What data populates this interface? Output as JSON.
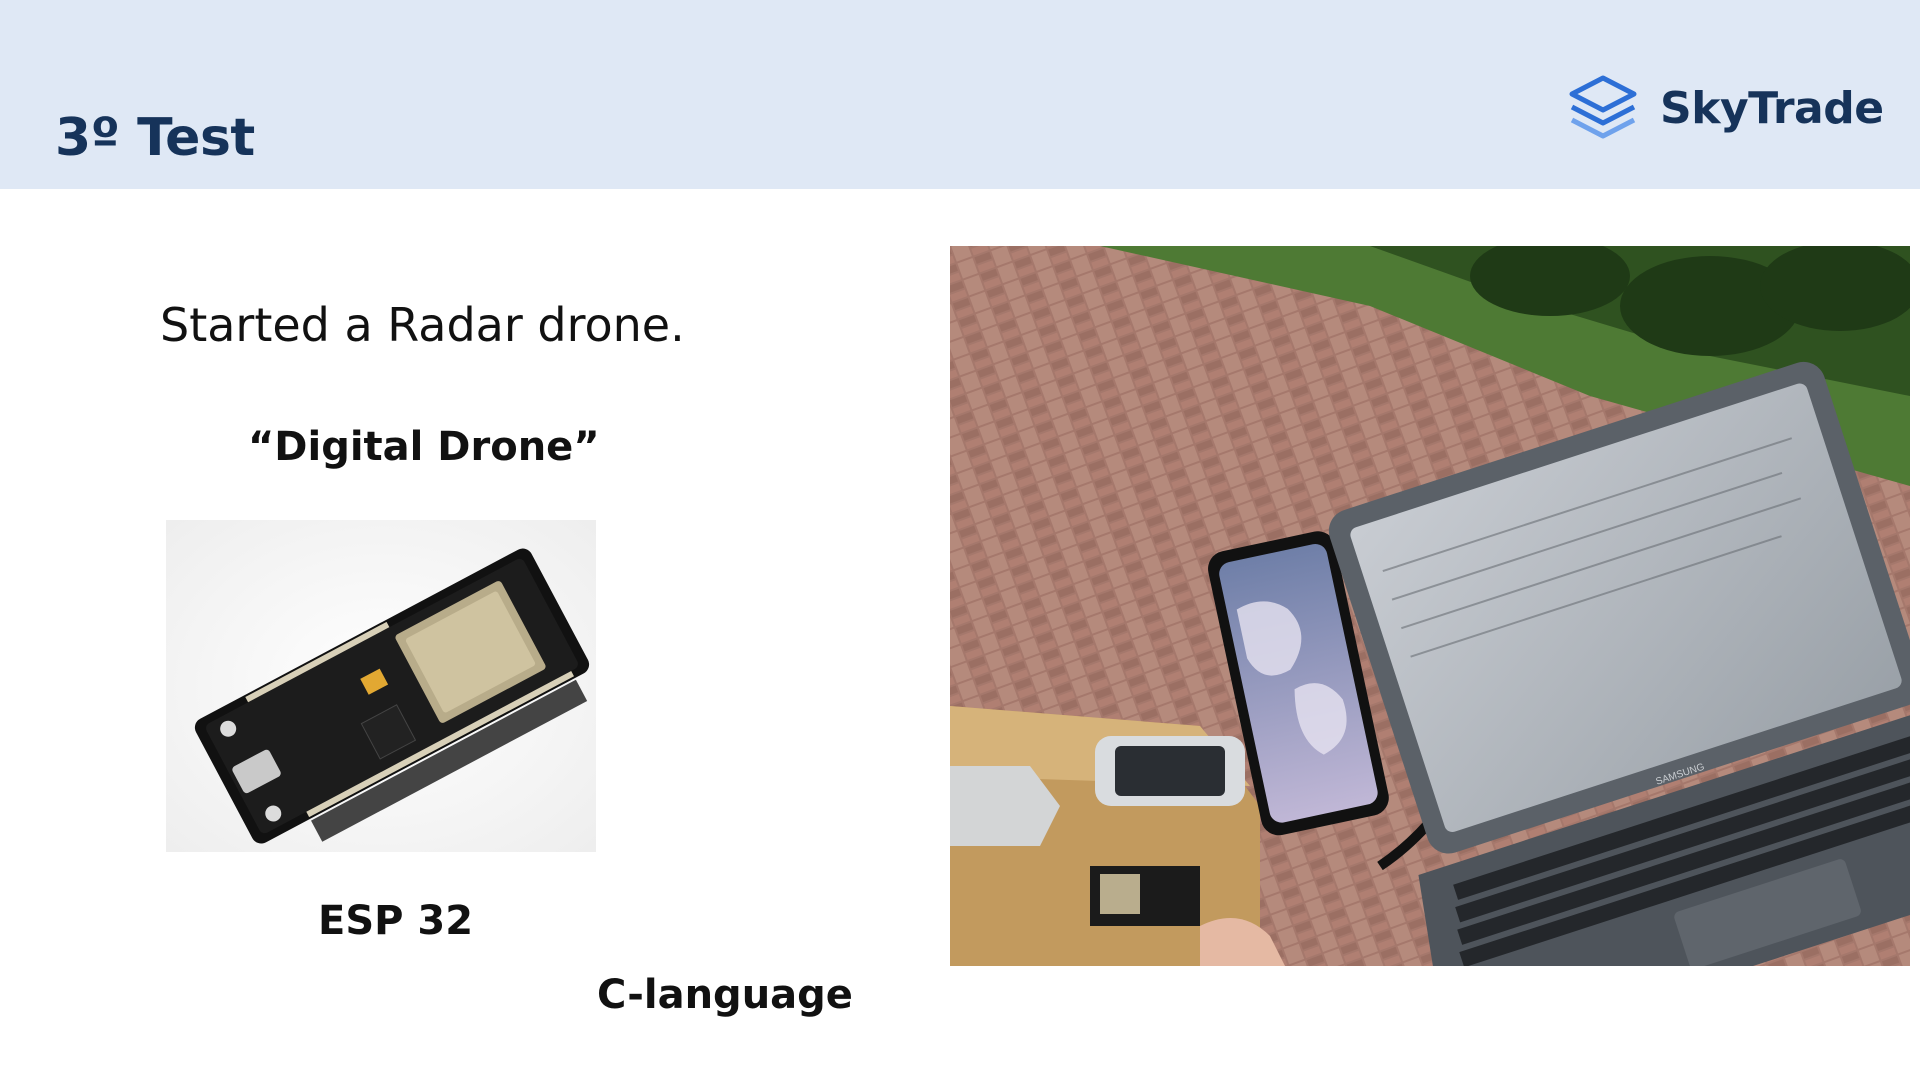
{
  "header": {
    "title": "3º Test"
  },
  "logo": {
    "name": "SkyTrade",
    "icon": "stacked-layers-icon",
    "color": "#16335a",
    "icon_color": "#2d6fd6"
  },
  "content": {
    "lead": "Started a Radar drone.",
    "quote": "“Digital Drone”",
    "board_label": "ESP 32",
    "language_label": "C-language"
  },
  "photo": {
    "laptop_brand": "SAMSUNG"
  },
  "colors": {
    "header_bg": "#dfe8f5",
    "title": "#16335a"
  }
}
